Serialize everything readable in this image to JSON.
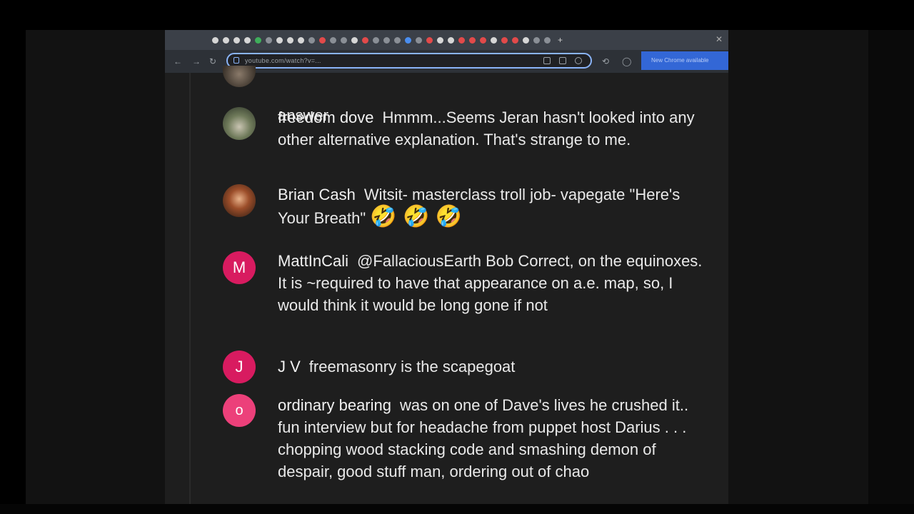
{
  "browser": {
    "url": "youtube.com/watch?v=...",
    "new_chrome_label": "New Chrome available"
  },
  "comments": [
    {
      "author": "",
      "avatar": "",
      "text": "answer"
    },
    {
      "author": "freedom dove",
      "avatar": "",
      "text": "Hmmm...Seems Jeran hasn't looked into any other alternative explanation. That's strange to me."
    },
    {
      "author": "Brian Cash",
      "avatar": "",
      "text": "Witsit- masterclass troll job- vapegate \"Here's Your Breath\"",
      "emoji": "🤣 🤣 🤣"
    },
    {
      "author": "MattInCali",
      "avatar": "M",
      "text": "@FallaciousEarth Bob Correct, on the equinoxes. It is ~required to have that appearance on a.e. map, so, I would think it would be long gone if not"
    },
    {
      "author": "J V",
      "avatar": "J",
      "text": "freemasonry is the scapegoat"
    },
    {
      "author": "ordinary bearing",
      "avatar": "o",
      "text": "was on one of Dave's lives he crushed it.. fun interview but for headache from puppet host Darius . . . chopping wood stacking code and smashing demon of despair, good stuff man, ordering out of chao"
    }
  ]
}
